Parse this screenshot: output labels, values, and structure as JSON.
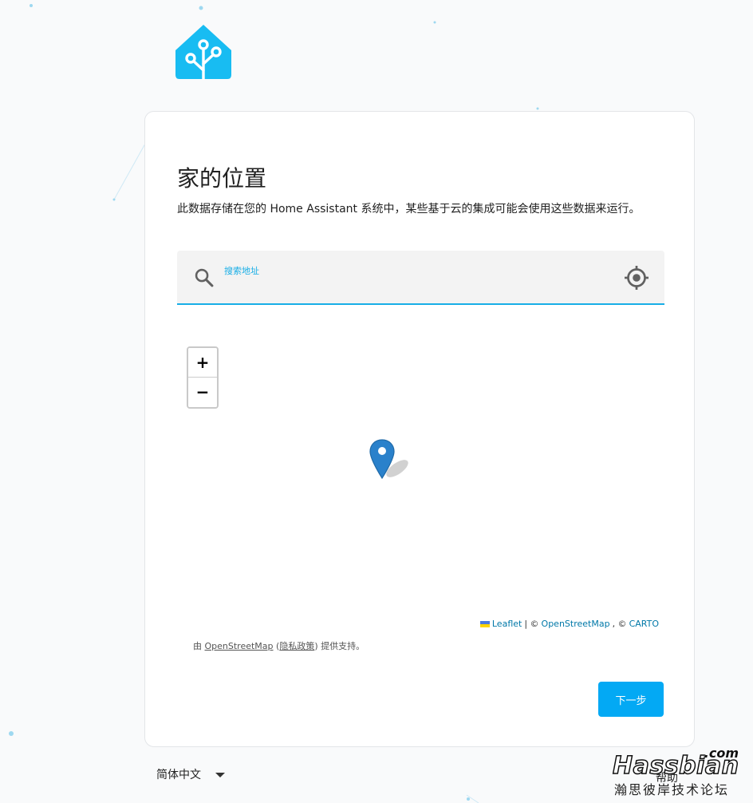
{
  "card": {
    "title": "家的位置",
    "description": "此数据存储在您的 Home Assistant 系统中，某些基于云的集成可能会使用这些数据来运行。"
  },
  "search": {
    "label": "搜索地址",
    "value": ""
  },
  "map": {
    "zoom_in": "+",
    "zoom_out": "−",
    "attribution": {
      "leaflet": "Leaflet",
      "sep1": "| ©",
      "osm": "OpenStreetMap",
      "sep2": ", ©",
      "carto": "CARTO"
    },
    "provider": {
      "prefix": "由",
      "osm": "OpenStreetMap",
      "open_paren": "(",
      "privacy": "隐私政策",
      "close_paren": ")",
      "suffix": "提供支持。"
    }
  },
  "actions": {
    "next": "下一步"
  },
  "footer": {
    "language": "简体中文",
    "help": "帮助"
  },
  "watermark": {
    "dotcom": ".com",
    "brand": "Hassbian",
    "cn": "瀚思彼岸技术论坛"
  },
  "colors": {
    "accent": "#03a9f4",
    "field_underline": "#18aee6",
    "marker": "#2a81cb",
    "logo": "#18bcf2"
  },
  "icons": {
    "logo": "home-assistant-logo-icon",
    "search": "magnifier-icon",
    "locate": "crosshair-target-icon",
    "marker": "map-pin-icon",
    "flag": "ukraine-flag-icon",
    "language_arrow": "caret-down-icon"
  }
}
